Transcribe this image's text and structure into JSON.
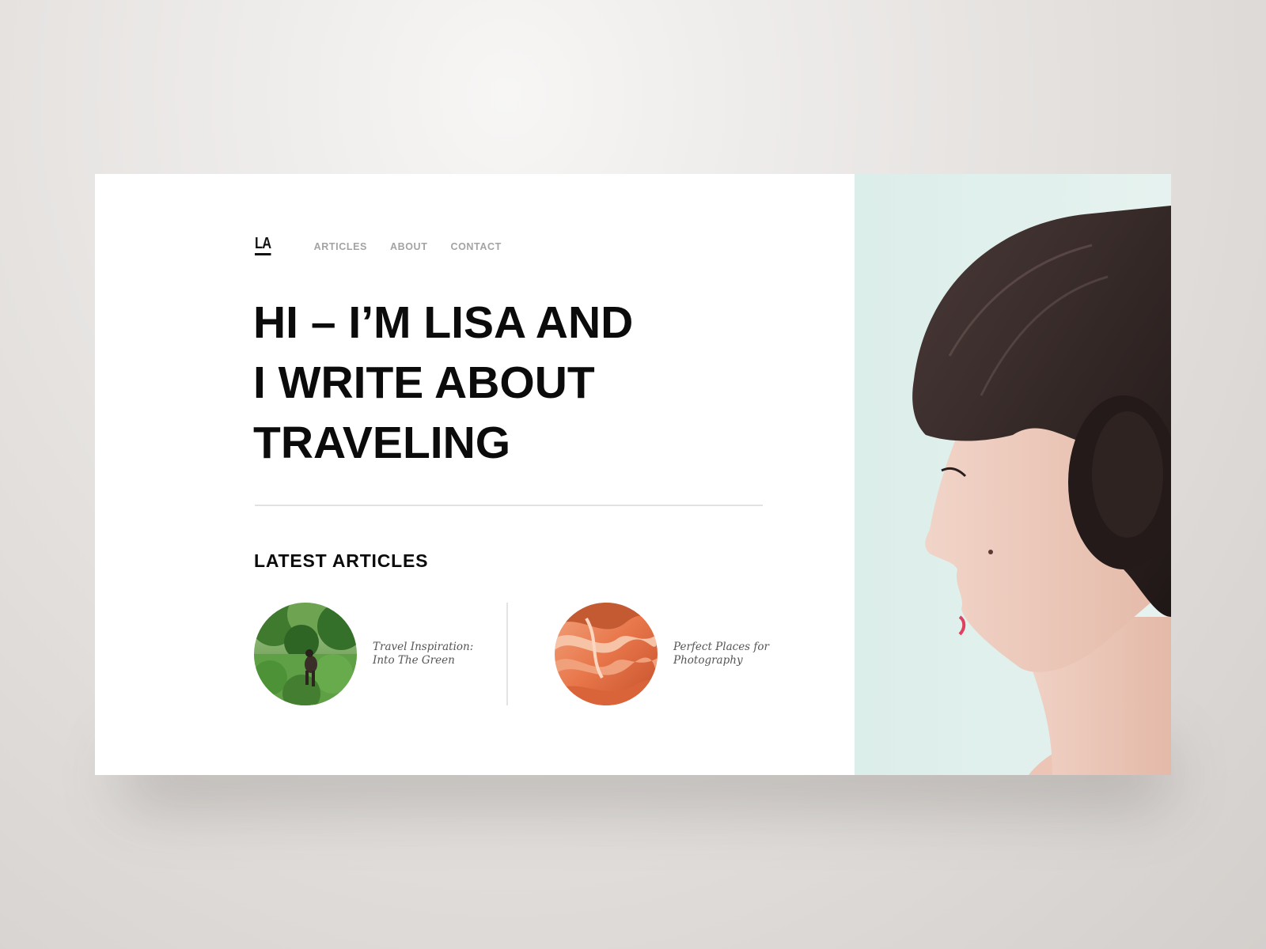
{
  "site": {
    "logo": "LA"
  },
  "nav": {
    "items": [
      {
        "label": "ARTICLES"
      },
      {
        "label": "ABOUT"
      },
      {
        "label": "CONTACT"
      }
    ]
  },
  "hero": {
    "lines": [
      "HI – I’M LISA AND",
      "I WRITE ABOUT",
      "TRAVELING"
    ]
  },
  "latest": {
    "title": "LATEST ARTICLES",
    "articles": [
      {
        "title_lines": [
          "Travel Inspiration:",
          "Into The Green"
        ],
        "thumb_icon": "forest-photo"
      },
      {
        "title_lines": [
          "Perfect Places for",
          "Photography"
        ],
        "thumb_icon": "canyon-photo"
      }
    ]
  },
  "colors": {
    "text": "#0b0b0b",
    "nav": "#a3a3a3",
    "photo_bg": "#dbeeea",
    "divider": "#e2e2e2"
  }
}
